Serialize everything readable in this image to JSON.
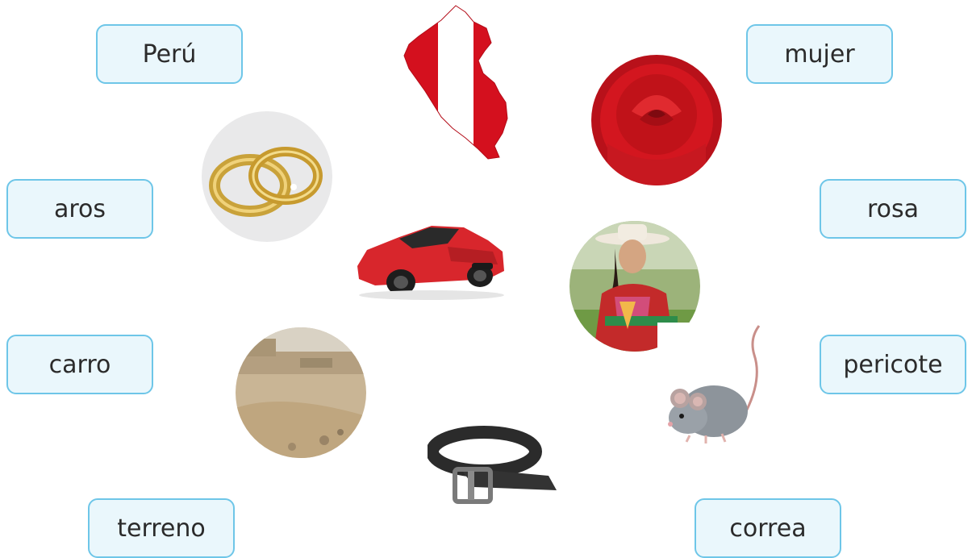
{
  "words": {
    "peru": "Perú",
    "aros": "aros",
    "carro": "carro",
    "terreno": "terreno",
    "mujer": "mujer",
    "rosa": "rosa",
    "pericote": "pericote",
    "correa": "correa"
  },
  "pictures": [
    "peru-map-flag",
    "gold-rings",
    "red-sports-car",
    "dirt-lot",
    "leather-belt",
    "red-rose",
    "woman-in-traditional-dress",
    "gray-mouse"
  ],
  "colors": {
    "box_border": "#6ec6e8",
    "box_fill": "#eaf7fc",
    "text": "#2b2b2b",
    "flag_red": "#d4101e"
  }
}
